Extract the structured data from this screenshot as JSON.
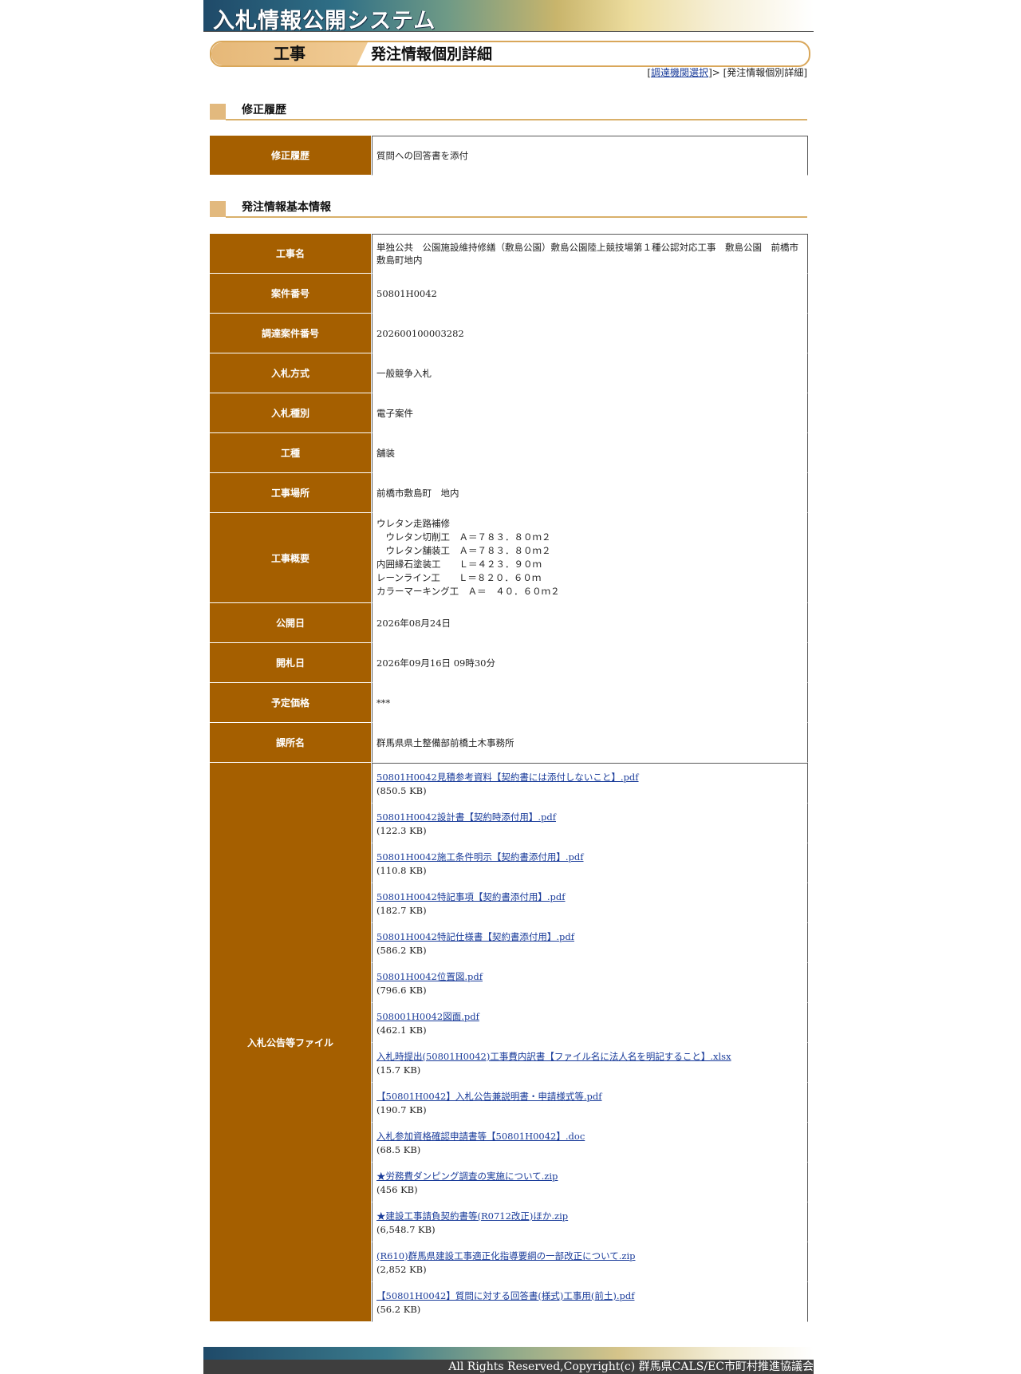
{
  "banner": {
    "title": "入札情報公開システム"
  },
  "header": {
    "category": "工事",
    "title": "発注情報個別詳細"
  },
  "breadcrumb": {
    "open": "[",
    "link": "調達機関選択",
    "sep": "]> [",
    "current": "発注情報個別詳細",
    "close": "]"
  },
  "sections": {
    "history": "修正履歴",
    "basic": "発注情報基本情報"
  },
  "history": {
    "label": "修正履歴",
    "value": "質問への回答書を添付"
  },
  "basic": [
    {
      "label": "工事名",
      "value": "単独公共　公園施設維持修繕（敷島公園）敷島公園陸上競技場第１種公認対応工事　敷島公園　前橋市敷島町地内"
    },
    {
      "label": "案件番号",
      "value": "50801H0042"
    },
    {
      "label": "調達案件番号",
      "value": "202600100003282"
    },
    {
      "label": "入札方式",
      "value": "一般競争入札"
    },
    {
      "label": "入札種別",
      "value": "電子案件"
    },
    {
      "label": "工種",
      "value": "舗装"
    },
    {
      "label": "工事場所",
      "value": "前橋市敷島町　地内"
    },
    {
      "label": "工事概要",
      "value": "ウレタン走路補修\n　ウレタン切削工　Ａ＝７８３．８０ｍ２\n　ウレタン舗装工　Ａ＝７８３．８０ｍ２\n内囲縁石塗装工　　Ｌ＝４２３．９０ｍ\nレーンライン工　　Ｌ＝８２０．６０ｍ\nカラーマーキング工　Ａ＝　４０．６０ｍ２"
    },
    {
      "label": "公開日",
      "value": "2026年08月24日"
    },
    {
      "label": "開札日",
      "value": "2026年09月16日 09時30分"
    },
    {
      "label": "予定価格",
      "value": "***"
    },
    {
      "label": "課所名",
      "value": "群馬県県土整備部前橋土木事務所"
    }
  ],
  "files": {
    "label": "入札公告等ファイル",
    "items": [
      {
        "name": "50801H0042見積参考資料【契約書には添付しないこと】.pdf",
        "size": "(850.5 KB)"
      },
      {
        "name": "50801H0042設計書【契約時添付用】.pdf",
        "size": "(122.3 KB)"
      },
      {
        "name": "50801H0042施工条件明示【契約書添付用】.pdf",
        "size": "(110.8 KB)"
      },
      {
        "name": "50801H0042特記事項【契約書添付用】.pdf",
        "size": "(182.7 KB)"
      },
      {
        "name": "50801H0042特記仕様書【契約書添付用】.pdf",
        "size": "(586.2 KB)"
      },
      {
        "name": "50801H0042位置図.pdf",
        "size": "(796.6 KB)"
      },
      {
        "name": "508001H0042図面.pdf",
        "size": "(462.1 KB)"
      },
      {
        "name": "入札時提出(50801H0042)工事費内訳書【ファイル名に法人名を明記すること】.xlsx",
        "size": "(15.7 KB)"
      },
      {
        "name": "【50801H0042】入札公告兼説明書・申請様式等.pdf",
        "size": "(190.7 KB)"
      },
      {
        "name": "入札参加資格確認申請書等【50801H0042】.doc",
        "size": "(68.5 KB)"
      },
      {
        "name": "★労務費ダンピング調査の実施について.zip",
        "size": "(456 KB)"
      },
      {
        "name": "★建設工事請負契約書等(R0712改正)ほか.zip",
        "size": "(6,548.7 KB)"
      },
      {
        "name": "(R610)群馬県建設工事適正化指導要綱の一部改正について.zip",
        "size": "(2,852 KB)"
      },
      {
        "name": "【50801H0042】質問に対する回答書(様式)工事用(前土).pdf",
        "size": "(56.2 KB)"
      }
    ]
  },
  "footer": {
    "copyright": "All Rights Reserved,Copyright(c) 群馬県CALS/EC市町村推進協議会"
  }
}
